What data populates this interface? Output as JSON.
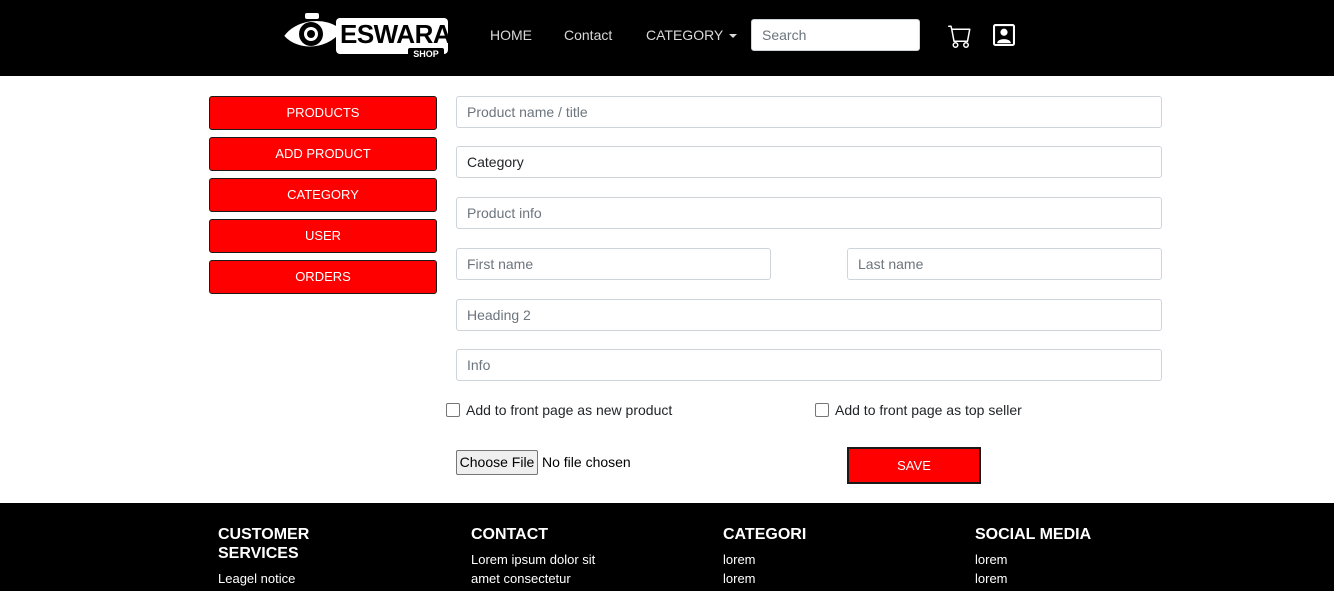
{
  "navbar": {
    "logo": {
      "text": "ESWARAN",
      "sub": "SHOP"
    },
    "links": [
      {
        "label": "HOME"
      },
      {
        "label": "Contact"
      },
      {
        "label": "CATEGORY"
      }
    ],
    "search": {
      "placeholder": "Search"
    },
    "icons": [
      "cart-icon",
      "user-profile-icon"
    ]
  },
  "sidebar": {
    "items": [
      {
        "label": "PRODUCTS"
      },
      {
        "label": "ADD PRODUCT"
      },
      {
        "label": "CATEGORY"
      },
      {
        "label": "USER"
      },
      {
        "label": "ORDERS"
      }
    ]
  },
  "form": {
    "product_name": {
      "placeholder": "Product name / title"
    },
    "category": {
      "value": "Category"
    },
    "product_info": {
      "placeholder": "Product info"
    },
    "first_name": {
      "placeholder": "First name"
    },
    "last_name": {
      "placeholder": "Last name"
    },
    "heading2": {
      "placeholder": "Heading 2"
    },
    "info": {
      "placeholder": "Info"
    },
    "checkbox_new": {
      "label": "Add to front page as new product",
      "checked": false
    },
    "checkbox_top": {
      "label": "Add to front page as top seller",
      "checked": false
    },
    "file": {
      "button": "Choose File",
      "status": "No file chosen"
    },
    "save_label": "SAVE"
  },
  "footer": {
    "customer_services": {
      "title_line1": "CUSTOMER",
      "title_line2": "SERVICES",
      "items": [
        "Leagel notice"
      ]
    },
    "contact": {
      "title": "CONTACT",
      "items": [
        "Lorem ipsum dolor sit",
        "amet consectetur"
      ]
    },
    "categori": {
      "title": "CATEGORI",
      "items": [
        "lorem",
        "lorem"
      ]
    },
    "social": {
      "title": "SOCIAL MEDIA",
      "items": [
        "lorem",
        "lorem"
      ]
    }
  },
  "colors": {
    "accent": "#ff0000",
    "nav_bg": "#000000",
    "footer_bg": "#000000"
  }
}
